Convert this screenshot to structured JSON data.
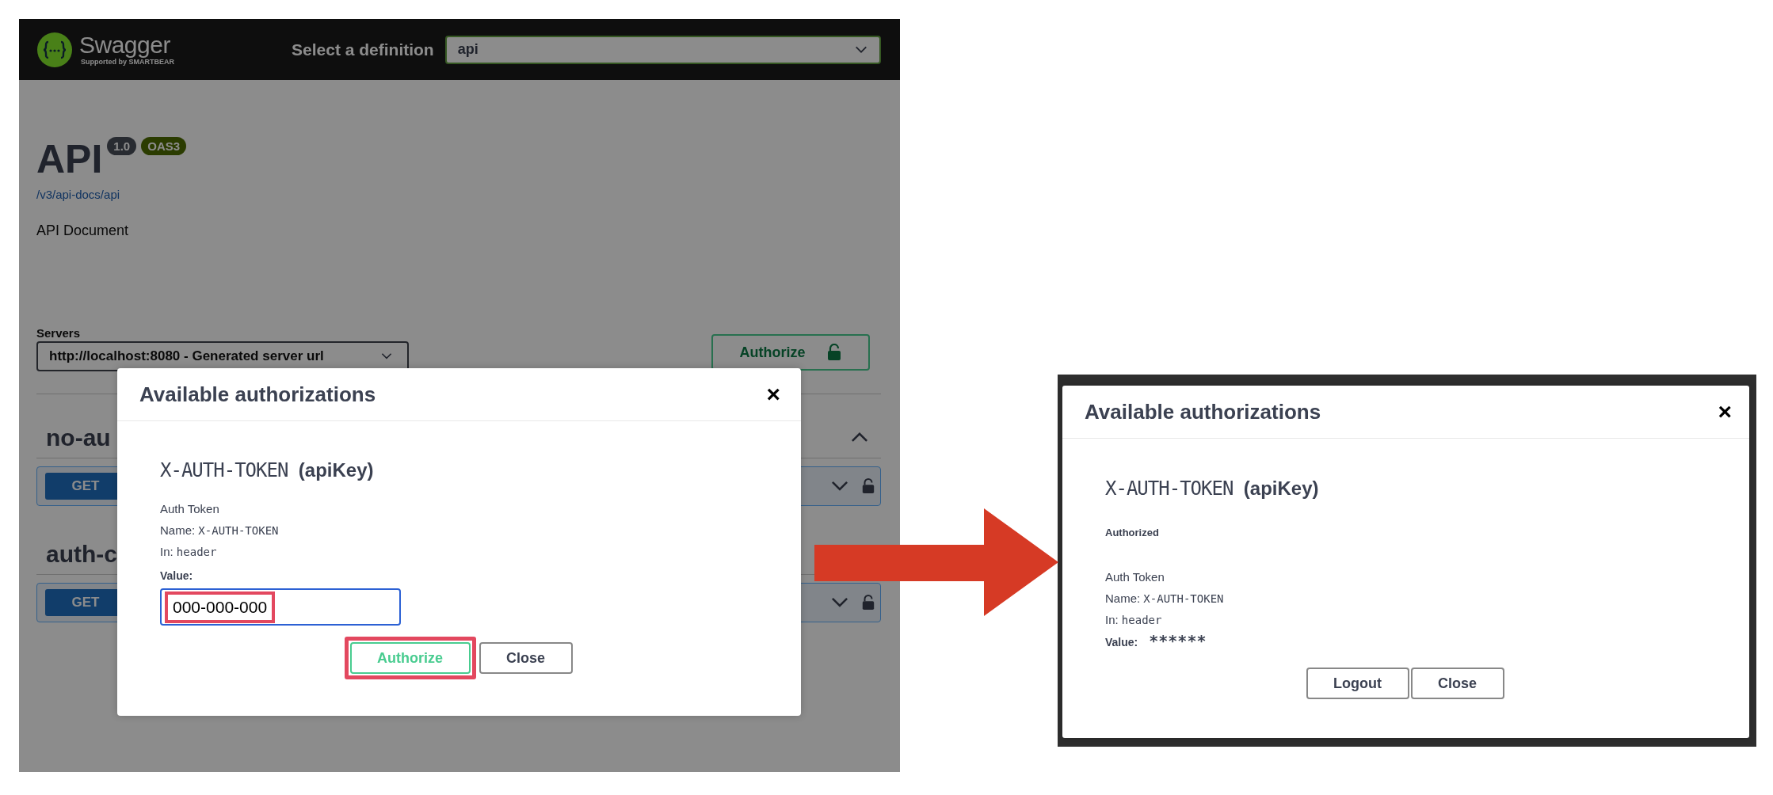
{
  "before": {
    "header": {
      "logo_text": "Swagger",
      "logo_sub": "Supported by SMARTBEAR",
      "definition_label": "Select a definition",
      "definition_value": "api"
    },
    "info": {
      "title": "API",
      "version": "1.0",
      "spec": "OAS3",
      "url": "/v3/api-docs/api",
      "description": "API Document"
    },
    "servers": {
      "label": "Servers",
      "value": "http://localhost:8080 - Generated server url"
    },
    "authorize_button": "Authorize",
    "sections": [
      {
        "name": "no-au",
        "expanded": true,
        "operations": [
          {
            "method": "GET"
          }
        ]
      },
      {
        "name": "auth-c",
        "operations": [
          {
            "method": "GET"
          }
        ]
      }
    ],
    "modal": {
      "title": "Available authorizations",
      "close": "×",
      "scheme": "X-AUTH-TOKEN",
      "scheme_type": "(apiKey)",
      "description": "Auth Token",
      "name_label": "Name:",
      "name": "X-AUTH-TOKEN",
      "in_label": "In:",
      "in": "header",
      "value_label": "Value:",
      "value_field": {
        "value": "000-000-000",
        "highlighted": true
      },
      "buttons": [
        {
          "kind": "authorize",
          "label": "Authorize",
          "highlighted": true
        },
        {
          "kind": "close",
          "label": "Close",
          "highlighted": false
        }
      ]
    }
  },
  "after": {
    "modal": {
      "title": "Available authorizations",
      "close": "×",
      "scheme": "X-AUTH-TOKEN",
      "scheme_type": "(apiKey)",
      "status": "Authorized",
      "description": "Auth Token",
      "name_label": "Name:",
      "name": "X-AUTH-TOKEN",
      "in_label": "In:",
      "in": "header",
      "value_label": "Value:",
      "masked_value": "******",
      "buttons": [
        {
          "kind": "logout",
          "label": "Logout",
          "highlighted": false
        },
        {
          "kind": "close",
          "label": "Close",
          "highlighted": false
        }
      ]
    }
  }
}
